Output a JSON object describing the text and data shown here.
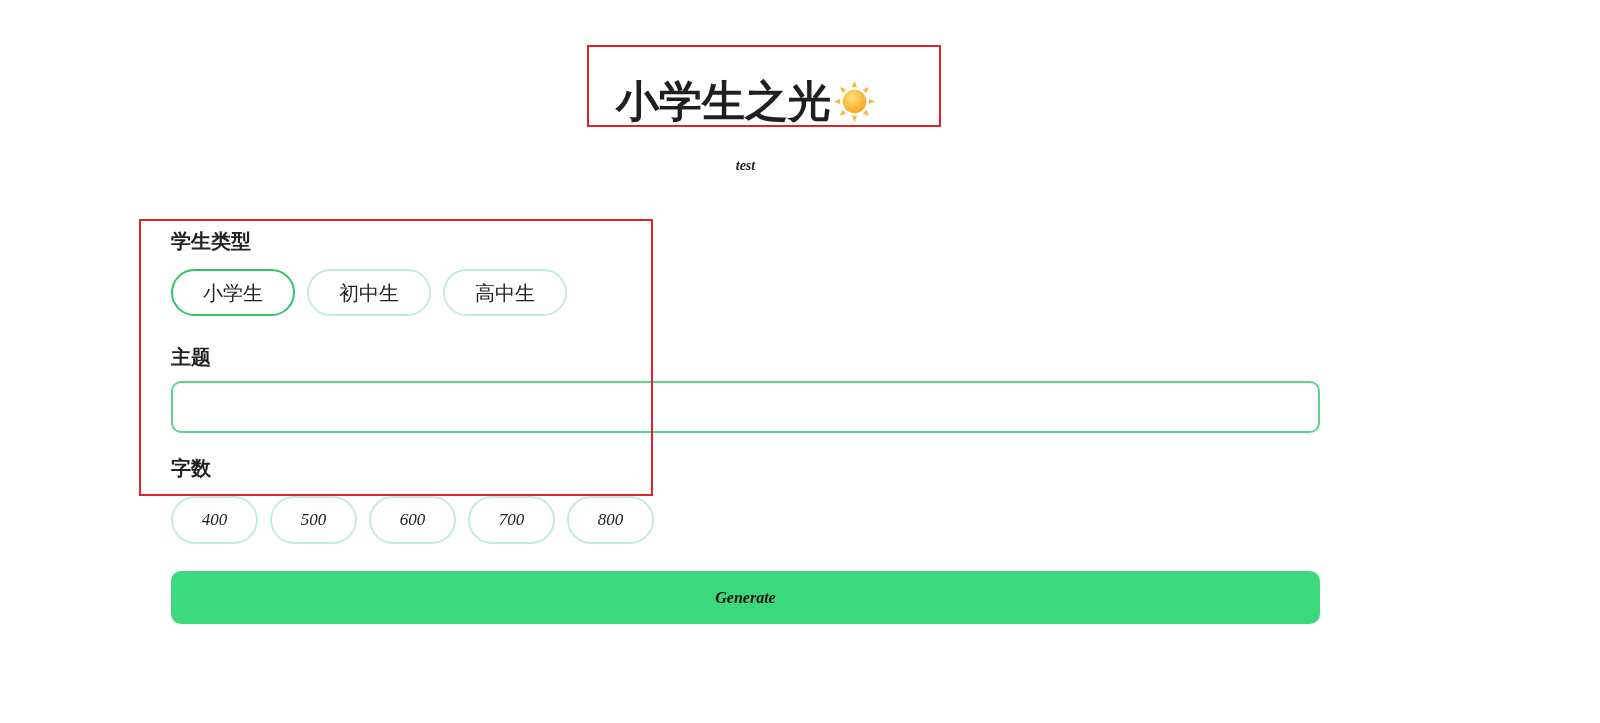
{
  "title": {
    "text": "小学生之光"
  },
  "subtitle": "test",
  "sections": [
    {
      "label": "学生类型",
      "kind": "text_choices",
      "options": [
        {
          "label": "小学生",
          "selected": true
        },
        {
          "label": "初中生",
          "selected": false
        },
        {
          "label": "高中生",
          "selected": false
        }
      ]
    },
    {
      "label": "主题",
      "kind": "text_input"
    },
    {
      "label": "字数",
      "kind": "number_choices",
      "options": [
        {
          "label": "400",
          "selected": false
        },
        {
          "label": "500",
          "selected": false
        },
        {
          "label": "600",
          "selected": false
        },
        {
          "label": "700",
          "selected": false
        },
        {
          "label": "800",
          "selected": false
        }
      ]
    }
  ],
  "generate_button": {
    "label": "Generate"
  }
}
